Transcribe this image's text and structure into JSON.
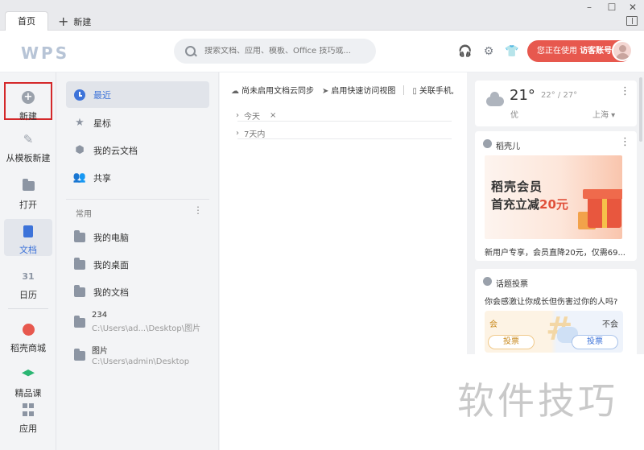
{
  "tabs": {
    "home": "首页",
    "new": "新建"
  },
  "header": {
    "logo": "WPS",
    "search_placeholder": "搜索文档、应用、模板、Office 技巧或...",
    "visitor_prefix": "您正在使用 ",
    "visitor_name": "访客账号"
  },
  "leftnav": {
    "new": "新建",
    "from_template": "从模板新建",
    "open": "打开",
    "docs": "文档",
    "calendar": "日历",
    "calendar_icon_text": "31",
    "store": "稻壳商城",
    "courses": "精品课",
    "apps": "应用"
  },
  "col2": {
    "recent": "最近",
    "starred": "星标",
    "cloud": "我的云文档",
    "shared": "共享",
    "common_header": "常用",
    "my_pc": "我的电脑",
    "my_desktop": "我的桌面",
    "my_docs": "我的文档",
    "folder1_name": "234",
    "folder1_path": "C:\\Users\\ad...\\Desktop\\图片",
    "folder2_name": "图片",
    "folder2_path": "C:\\Users\\admin\\Desktop"
  },
  "main": {
    "tool1": "尚未启用文档云同步",
    "tool2": "启用快速访问视图",
    "tool3": "关联手机,",
    "group_today": "今天",
    "group_7days": "7天内"
  },
  "weather": {
    "temp": "21°",
    "range": "22° / 27°",
    "quality": "优",
    "city": "上海"
  },
  "ad": {
    "title": "稻壳儿",
    "banner_line1": "稻壳会员",
    "banner_line2a": "首充立减",
    "banner_line2b": "20元",
    "text": "新用户专享，会员直降20元，仅需69..."
  },
  "poll": {
    "title": "话题投票",
    "question": "你会感激让你成长但伤害过你的人吗?",
    "yes": "会",
    "no": "不会",
    "vote": "投票"
  },
  "watermark": "软件技巧"
}
